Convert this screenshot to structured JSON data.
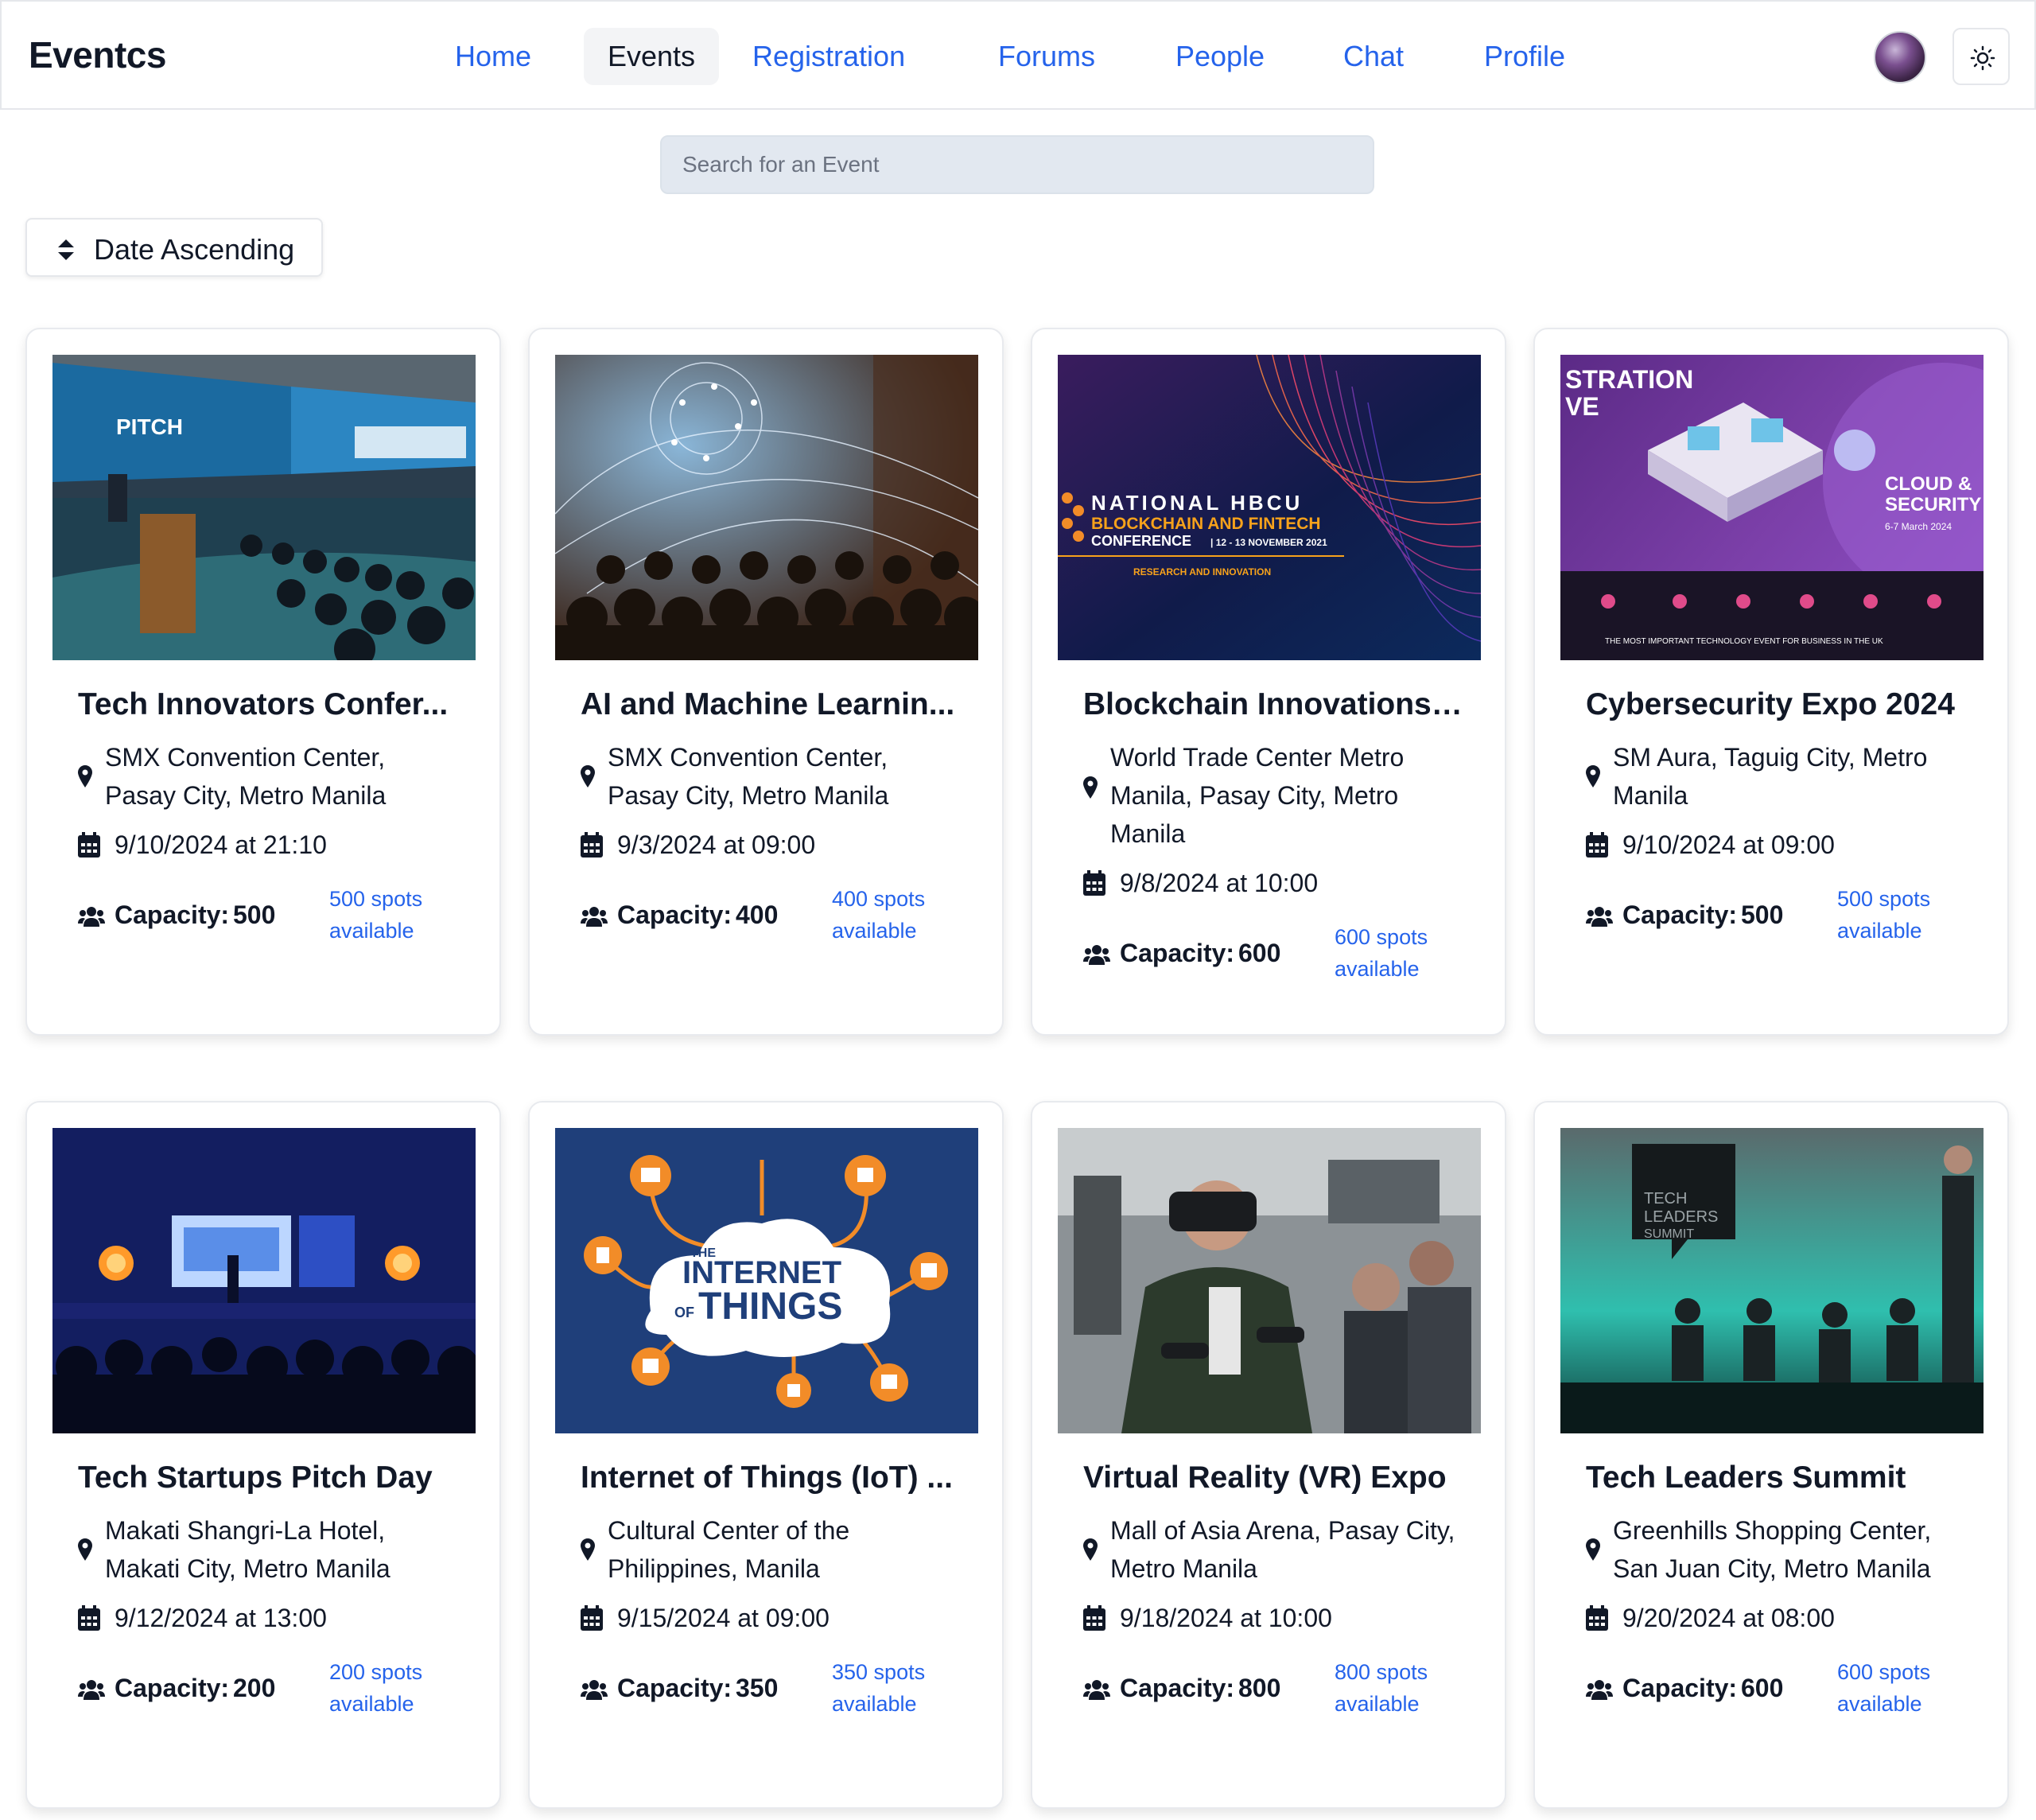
{
  "header": {
    "brand": "Eventcs",
    "nav": [
      {
        "label": "Home",
        "active": false
      },
      {
        "label": "Events",
        "active": true
      },
      {
        "label": "Registration",
        "active": false
      },
      {
        "label": "Forums",
        "active": false
      },
      {
        "label": "People",
        "active": false
      },
      {
        "label": "Chat",
        "active": false
      },
      {
        "label": "Profile",
        "active": false
      }
    ],
    "avatar_icon": "user-avatar",
    "theme_icon": "sun-icon"
  },
  "search": {
    "placeholder": "Search for an Event",
    "value": ""
  },
  "sort": {
    "label": "Date Ascending",
    "icon": "sort-icon"
  },
  "labels": {
    "capacity": "Capacity:"
  },
  "colors": {
    "accent": "#2563eb",
    "text": "#111827",
    "search_bg": "#e2e8f0"
  },
  "events": [
    {
      "title": "Tech Innovators Confer...",
      "location": "SMX Convention Center, Pasay City, Metro Manila",
      "date": "9/10/2024 at 21:10",
      "capacity": "500",
      "spots": "500 spots available"
    },
    {
      "title": "AI and Machine Learnin...",
      "location": "SMX Convention Center, Pasay City, Metro Manila",
      "date": "9/3/2024 at 09:00",
      "capacity": "400",
      "spots": "400 spots available"
    },
    {
      "title": "Blockchain Innovations ...",
      "location": "World Trade Center Metro Manila, Pasay City, Metro Manila",
      "date": "9/8/2024 at 10:00",
      "capacity": "600",
      "spots": "600 spots available"
    },
    {
      "title": "Cybersecurity Expo 2024",
      "location": "SM Aura, Taguig City, Metro Manila",
      "date": "9/10/2024 at 09:00",
      "capacity": "500",
      "spots": "500 spots available"
    },
    {
      "title": "Tech Startups Pitch Day",
      "location": "Makati Shangri-La Hotel, Makati City, Metro Manila",
      "date": "9/12/2024 at 13:00",
      "capacity": "200",
      "spots": "200 spots available"
    },
    {
      "title": "Internet of Things (IoT) ...",
      "location": "Cultural Center of the Philippines, Manila",
      "date": "9/15/2024 at 09:00",
      "capacity": "350",
      "spots": "350 spots available"
    },
    {
      "title": "Virtual Reality (VR) Expo",
      "location": "Mall of Asia Arena, Pasay City, Metro Manila",
      "date": "9/18/2024 at 10:00",
      "capacity": "800",
      "spots": "800 spots available"
    },
    {
      "title": "Tech Leaders Summit",
      "location": "Greenhills Shopping Center, San Juan City, Metro Manila",
      "date": "9/20/2024 at 08:00",
      "capacity": "600",
      "spots": "600 spots available"
    }
  ],
  "banners": {
    "blockchain": {
      "line1": "NATIONAL HBCU",
      "line2": "BLOCKCHAIN AND FINTECH",
      "line3": "CONFERENCE",
      "dates": "| 12 - 13 NOVEMBER 2021",
      "line4": "RESEARCH AND INNOVATION"
    },
    "cyber": {
      "corner_top": "STRATION",
      "corner_bottom": "VE",
      "brand": "CLOUD &",
      "brand2": "SECURITY",
      "date": "6-7 March 2024",
      "footer": "THE MOST IMPORTANT TECHNOLOGY EVENT FOR BUSINESS IN THE UK"
    },
    "pitch": {
      "sign": "PITCH"
    },
    "iot": {
      "line1": "THE",
      "line2": "INTERNET",
      "line3": "OF",
      "line4": "THINGS"
    },
    "leaders": {
      "sign1": "TECH",
      "sign2": "LEADERS",
      "sign3": "SUMMIT"
    }
  }
}
